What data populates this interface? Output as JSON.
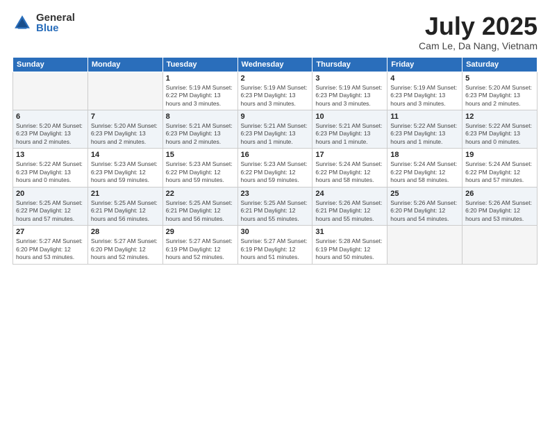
{
  "header": {
    "logo_general": "General",
    "logo_blue": "Blue",
    "title": "July 2025",
    "subtitle": "Cam Le, Da Nang, Vietnam"
  },
  "days_of_week": [
    "Sunday",
    "Monday",
    "Tuesday",
    "Wednesday",
    "Thursday",
    "Friday",
    "Saturday"
  ],
  "weeks": [
    [
      {
        "day": "",
        "info": ""
      },
      {
        "day": "",
        "info": ""
      },
      {
        "day": "1",
        "info": "Sunrise: 5:19 AM\nSunset: 6:22 PM\nDaylight: 13 hours and 3 minutes."
      },
      {
        "day": "2",
        "info": "Sunrise: 5:19 AM\nSunset: 6:23 PM\nDaylight: 13 hours and 3 minutes."
      },
      {
        "day": "3",
        "info": "Sunrise: 5:19 AM\nSunset: 6:23 PM\nDaylight: 13 hours and 3 minutes."
      },
      {
        "day": "4",
        "info": "Sunrise: 5:19 AM\nSunset: 6:23 PM\nDaylight: 13 hours and 3 minutes."
      },
      {
        "day": "5",
        "info": "Sunrise: 5:20 AM\nSunset: 6:23 PM\nDaylight: 13 hours and 2 minutes."
      }
    ],
    [
      {
        "day": "6",
        "info": "Sunrise: 5:20 AM\nSunset: 6:23 PM\nDaylight: 13 hours and 2 minutes."
      },
      {
        "day": "7",
        "info": "Sunrise: 5:20 AM\nSunset: 6:23 PM\nDaylight: 13 hours and 2 minutes."
      },
      {
        "day": "8",
        "info": "Sunrise: 5:21 AM\nSunset: 6:23 PM\nDaylight: 13 hours and 2 minutes."
      },
      {
        "day": "9",
        "info": "Sunrise: 5:21 AM\nSunset: 6:23 PM\nDaylight: 13 hours and 1 minute."
      },
      {
        "day": "10",
        "info": "Sunrise: 5:21 AM\nSunset: 6:23 PM\nDaylight: 13 hours and 1 minute."
      },
      {
        "day": "11",
        "info": "Sunrise: 5:22 AM\nSunset: 6:23 PM\nDaylight: 13 hours and 1 minute."
      },
      {
        "day": "12",
        "info": "Sunrise: 5:22 AM\nSunset: 6:23 PM\nDaylight: 13 hours and 0 minutes."
      }
    ],
    [
      {
        "day": "13",
        "info": "Sunrise: 5:22 AM\nSunset: 6:23 PM\nDaylight: 13 hours and 0 minutes."
      },
      {
        "day": "14",
        "info": "Sunrise: 5:23 AM\nSunset: 6:23 PM\nDaylight: 12 hours and 59 minutes."
      },
      {
        "day": "15",
        "info": "Sunrise: 5:23 AM\nSunset: 6:22 PM\nDaylight: 12 hours and 59 minutes."
      },
      {
        "day": "16",
        "info": "Sunrise: 5:23 AM\nSunset: 6:22 PM\nDaylight: 12 hours and 59 minutes."
      },
      {
        "day": "17",
        "info": "Sunrise: 5:24 AM\nSunset: 6:22 PM\nDaylight: 12 hours and 58 minutes."
      },
      {
        "day": "18",
        "info": "Sunrise: 5:24 AM\nSunset: 6:22 PM\nDaylight: 12 hours and 58 minutes."
      },
      {
        "day": "19",
        "info": "Sunrise: 5:24 AM\nSunset: 6:22 PM\nDaylight: 12 hours and 57 minutes."
      }
    ],
    [
      {
        "day": "20",
        "info": "Sunrise: 5:25 AM\nSunset: 6:22 PM\nDaylight: 12 hours and 57 minutes."
      },
      {
        "day": "21",
        "info": "Sunrise: 5:25 AM\nSunset: 6:21 PM\nDaylight: 12 hours and 56 minutes."
      },
      {
        "day": "22",
        "info": "Sunrise: 5:25 AM\nSunset: 6:21 PM\nDaylight: 12 hours and 56 minutes."
      },
      {
        "day": "23",
        "info": "Sunrise: 5:25 AM\nSunset: 6:21 PM\nDaylight: 12 hours and 55 minutes."
      },
      {
        "day": "24",
        "info": "Sunrise: 5:26 AM\nSunset: 6:21 PM\nDaylight: 12 hours and 55 minutes."
      },
      {
        "day": "25",
        "info": "Sunrise: 5:26 AM\nSunset: 6:20 PM\nDaylight: 12 hours and 54 minutes."
      },
      {
        "day": "26",
        "info": "Sunrise: 5:26 AM\nSunset: 6:20 PM\nDaylight: 12 hours and 53 minutes."
      }
    ],
    [
      {
        "day": "27",
        "info": "Sunrise: 5:27 AM\nSunset: 6:20 PM\nDaylight: 12 hours and 53 minutes."
      },
      {
        "day": "28",
        "info": "Sunrise: 5:27 AM\nSunset: 6:20 PM\nDaylight: 12 hours and 52 minutes."
      },
      {
        "day": "29",
        "info": "Sunrise: 5:27 AM\nSunset: 6:19 PM\nDaylight: 12 hours and 52 minutes."
      },
      {
        "day": "30",
        "info": "Sunrise: 5:27 AM\nSunset: 6:19 PM\nDaylight: 12 hours and 51 minutes."
      },
      {
        "day": "31",
        "info": "Sunrise: 5:28 AM\nSunset: 6:19 PM\nDaylight: 12 hours and 50 minutes."
      },
      {
        "day": "",
        "info": ""
      },
      {
        "day": "",
        "info": ""
      }
    ]
  ]
}
